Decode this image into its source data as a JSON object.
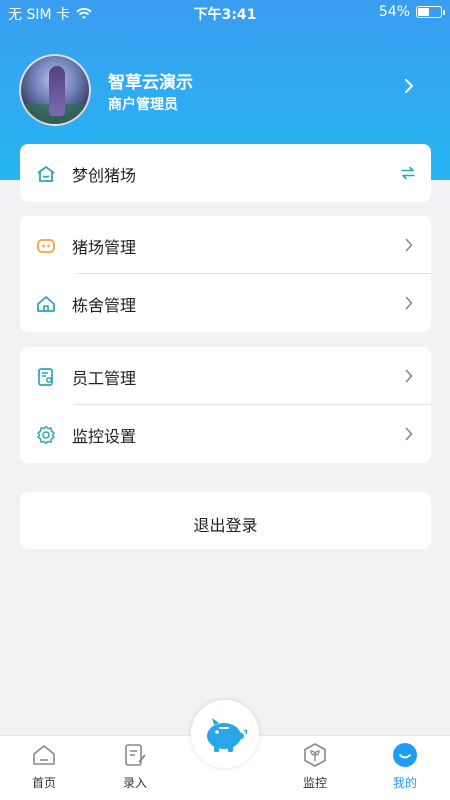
{
  "status_bar": {
    "carrier": "无 SIM 卡",
    "time": "下午3:41",
    "battery_percent": "54%",
    "battery_level": 0.54
  },
  "profile": {
    "name": "智草云演示",
    "role": "商户管理员"
  },
  "farm_card": {
    "label": "梦创猪场",
    "icon": "farm-house-icon",
    "action_icon": "switch-icon"
  },
  "management_group": [
    {
      "label": "猪场管理",
      "icon": "pig-nose-icon"
    },
    {
      "label": "栋舍管理",
      "icon": "house-icon"
    }
  ],
  "staff_group": [
    {
      "label": "员工管理",
      "icon": "staff-card-icon"
    },
    {
      "label": "监控设置",
      "icon": "gear-icon"
    }
  ],
  "logout": {
    "label": "退出登录"
  },
  "tab_bar": {
    "tabs": [
      {
        "label": "首页",
        "icon": "home-icon",
        "active": false
      },
      {
        "label": "录入",
        "icon": "edit-note-icon",
        "active": false
      },
      {
        "label": "监控",
        "icon": "monitor-cube-icon",
        "active": false
      },
      {
        "label": "我的",
        "icon": "smile-icon",
        "active": true
      }
    ],
    "center_icon": "piggy-bank-icon"
  },
  "colors": {
    "header_top": "#3a9df0",
    "header_bottom": "#26b6f3",
    "accent": "#1f9df2",
    "icon_orange": "#f0a534",
    "icon_teal": "#2aa6b8"
  }
}
